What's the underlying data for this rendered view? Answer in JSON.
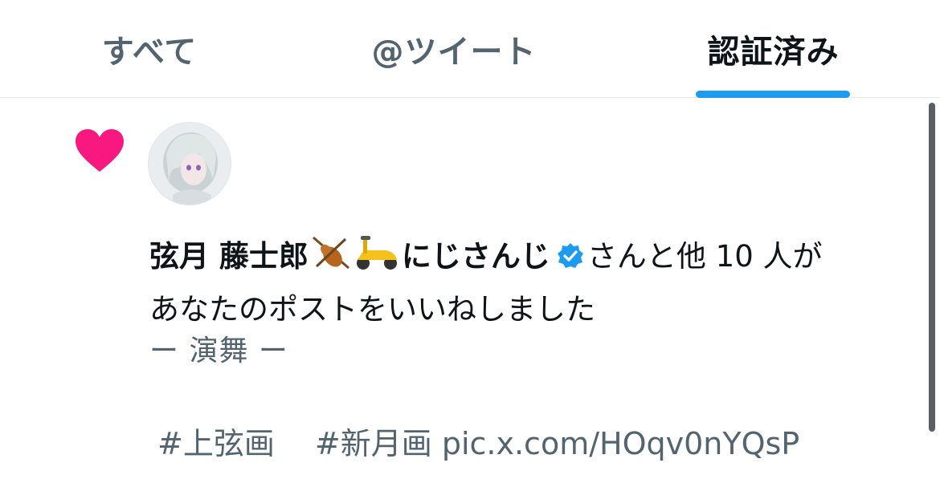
{
  "tabs": [
    {
      "label": "すべて",
      "active": false
    },
    {
      "label": "@ツイート",
      "active": false
    },
    {
      "label": "認証済み",
      "active": true
    }
  ],
  "notification": {
    "icon": "heart-icon",
    "user_name": "弦月 藤士郎",
    "emojis": [
      "violin-icon",
      "scooter-icon"
    ],
    "org_name": "にじさんじ",
    "verified_icon": "verified-badge-icon",
    "message_line1": "さんと他 10 人が",
    "message_line2": "あなたのポストをいいねしました",
    "post_title": "ー 演舞 ー",
    "post_tags": "#上弦画　 #新月画 pic.x.com/HOqv0nYQsP"
  },
  "colors": {
    "heart": "#f91880",
    "accent": "#1d9bf0",
    "secondary_text": "#536471"
  }
}
